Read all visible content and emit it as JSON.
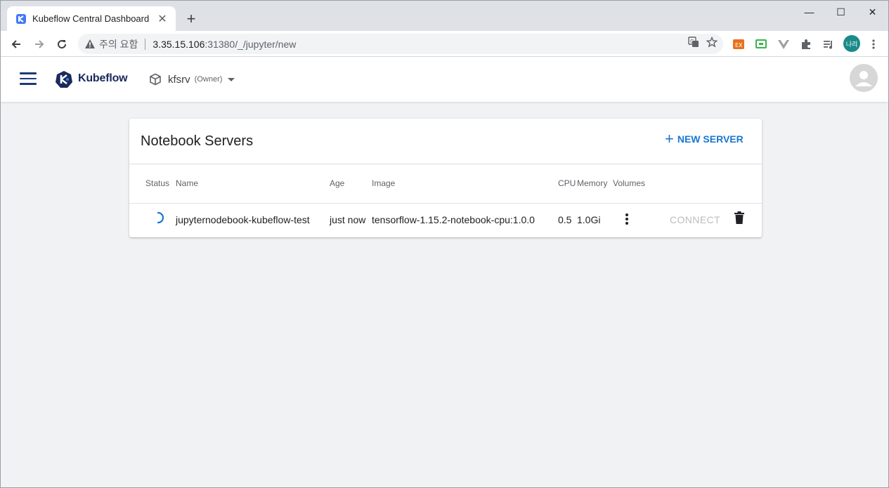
{
  "browser": {
    "tab_title": "Kubeflow Central Dashboard",
    "tab_close": "✕",
    "new_tab": "+",
    "win_min": "—",
    "win_max": "☐",
    "win_close": "✕",
    "security_label": "주의 요함",
    "url_host": "3.35.15.106",
    "url_rest": ":31380/_/jupyter/new",
    "profile_initials": "나리"
  },
  "app": {
    "brand": "Kubeflow",
    "namespace": "kfsrv",
    "namespace_role": "(Owner)"
  },
  "card": {
    "title": "Notebook Servers",
    "new_server_plus": "+",
    "new_server_label": "NEW SERVER",
    "columns": [
      "Status",
      "Name",
      "Age",
      "Image",
      "CPU",
      "Memory",
      "Volumes"
    ],
    "rows": [
      {
        "name": "jupyternodebook-kubeflow-test",
        "age": "just now",
        "image": "tensorflow-1.15.2-notebook-cpu:1.0.0",
        "cpu": "0.5",
        "memory": "1.0Gi",
        "connect": "CONNECT"
      }
    ]
  },
  "colors": {
    "accent": "#1976d2",
    "brand_dark": "#1a2a5a",
    "disabled": "#bdbdbd"
  }
}
